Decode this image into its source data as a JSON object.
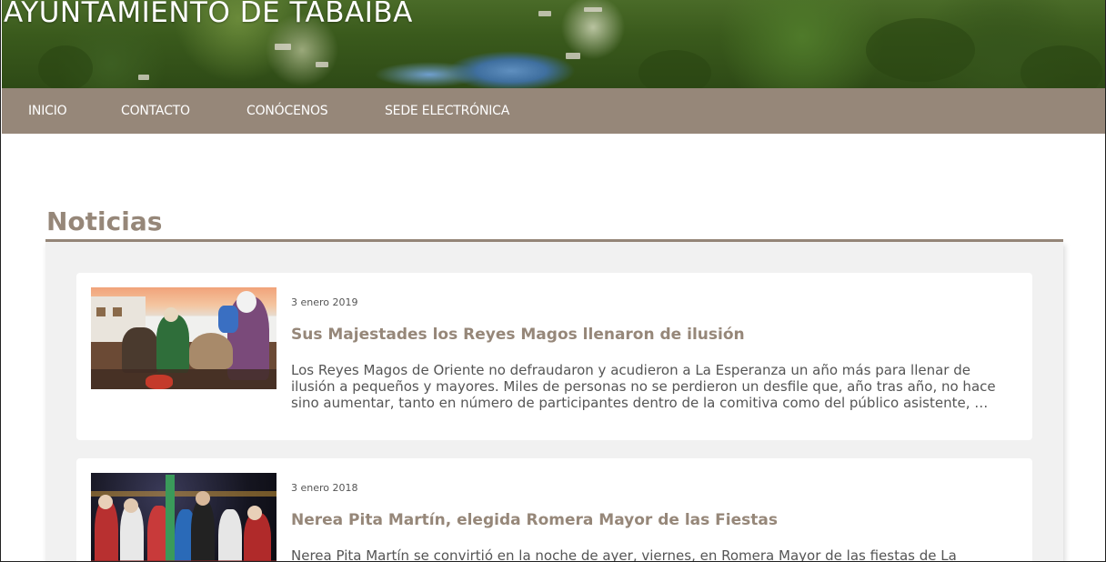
{
  "header": {
    "site_title": "AYUNTAMIENTO DE TABAIBA"
  },
  "nav": {
    "items": [
      {
        "label": "INICIO"
      },
      {
        "label": "CONTACTO"
      },
      {
        "label": "CONÓCENOS"
      },
      {
        "label": "SEDE ELECTRÓNICA"
      }
    ]
  },
  "main": {
    "section_title": "Noticias",
    "news": [
      {
        "date": "3 enero 2019",
        "title": "Sus Majestades los Reyes Magos llenaron de ilusión",
        "excerpt": "Los Reyes Magos de Oriente no defraudaron y acudieron a La Esperanza un año más para llenar de ilusión a pequeños y mayores. Miles de personas no se perdieron un desfile que, año tras año, no hace sino aumentar, tanto en número de participantes dentro de la comitiva como del público asistente, …"
      },
      {
        "date": "3 enero 2018",
        "title": "Nerea Pita Martín, elegida Romera Mayor de las Fiestas",
        "excerpt": "Nerea Pita Martín se convirtió en la noche de ayer, viernes, en Romera Mayor de las fiestas de La"
      }
    ]
  },
  "colors": {
    "accent": "#968779",
    "panel_bg": "#f1f1f1",
    "text": "#555555"
  }
}
